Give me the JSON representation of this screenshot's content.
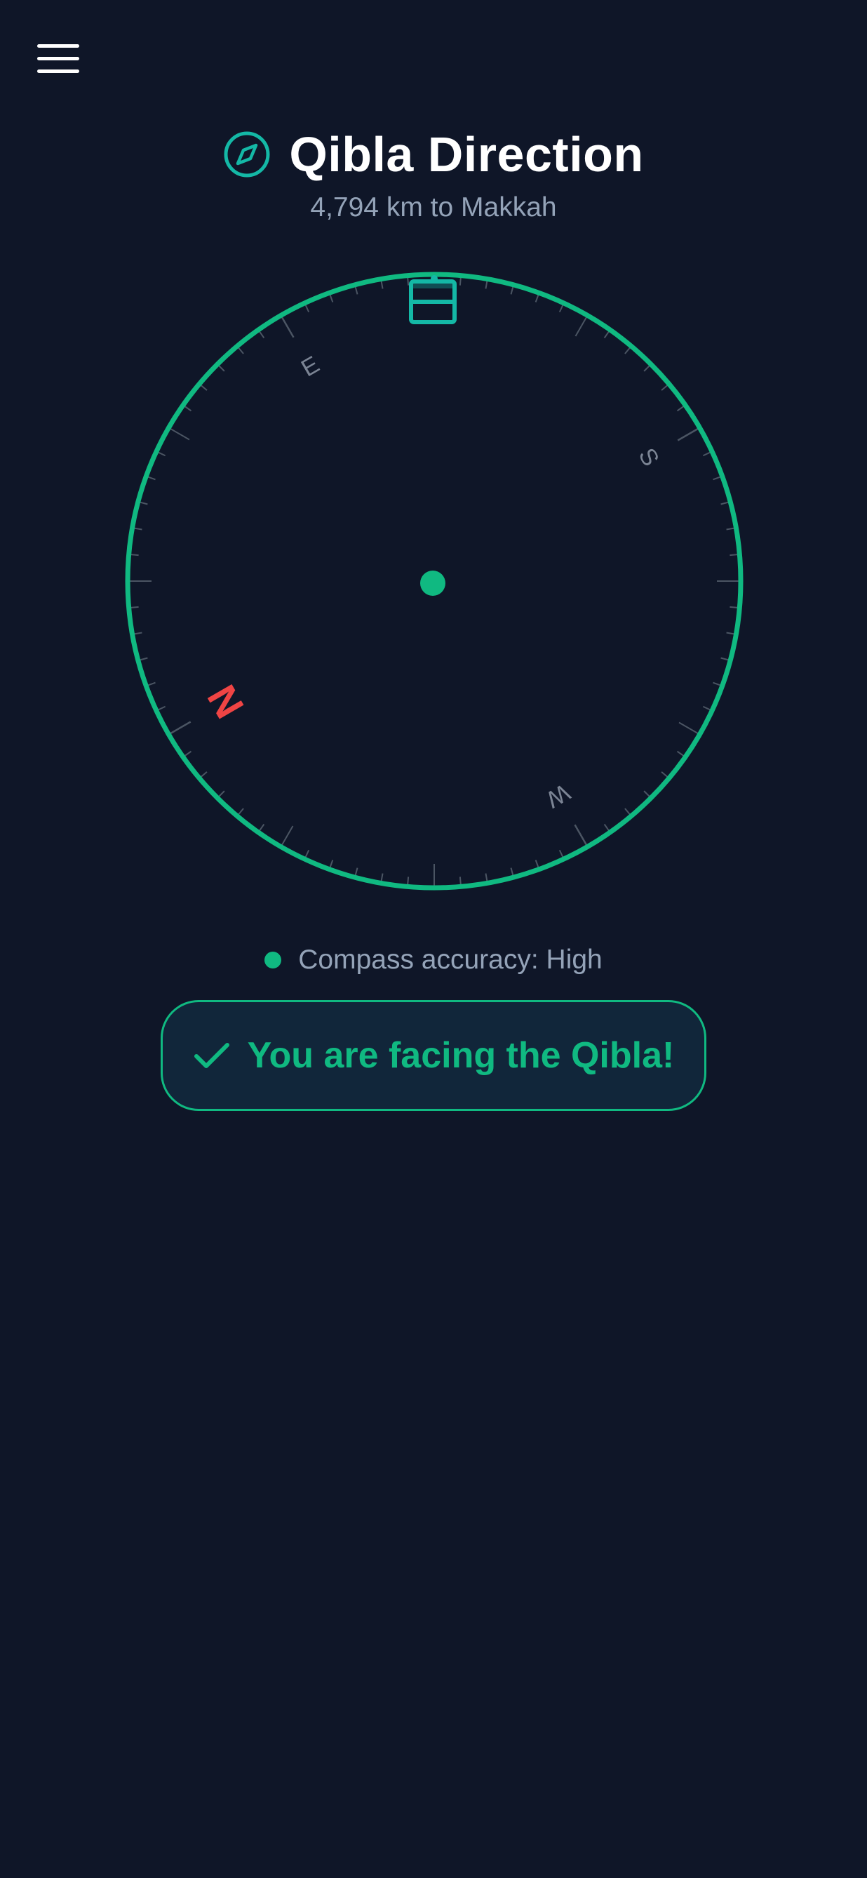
{
  "header": {
    "title": "Qibla Direction",
    "distance": "4,794 km to Makkah",
    "icon": "compass-icon"
  },
  "menu": {
    "icon": "hamburger-menu-icon"
  },
  "compass": {
    "cardinals": {
      "north": "N",
      "east": "E",
      "south": "S",
      "west": "W"
    },
    "north_bearing_deg": 240,
    "qibla_icon": "kaaba-icon",
    "colors": {
      "ring": "#10b981",
      "north": "#ef4444",
      "tick": "#4b5563",
      "cardinal": "#7b8494"
    }
  },
  "accuracy": {
    "label": "Compass accuracy: High",
    "status_color": "#10b981"
  },
  "status": {
    "message": "You are facing the Qibla!",
    "icon": "check-icon"
  },
  "colors": {
    "background": "#0f1628",
    "accent": "#10b981",
    "muted_text": "#94a3b8"
  }
}
